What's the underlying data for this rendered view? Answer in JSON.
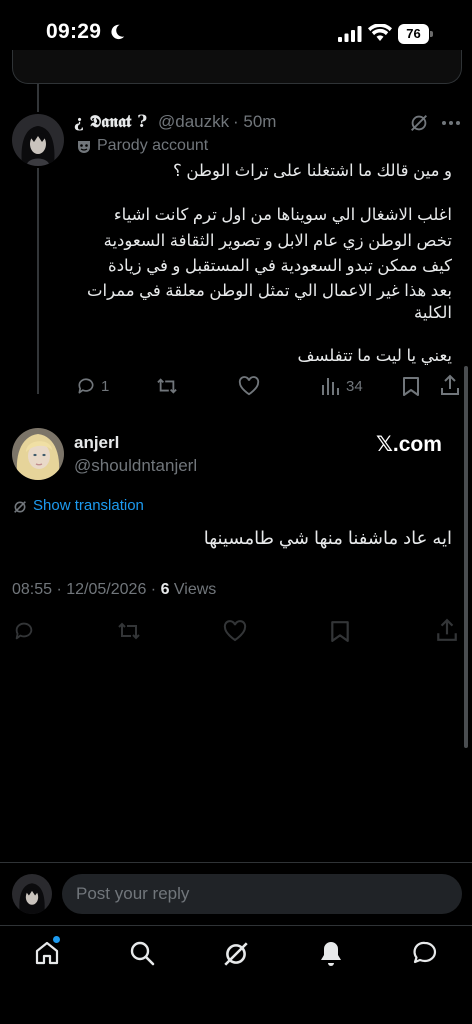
{
  "status_bar": {
    "time": "09:29",
    "battery": "76"
  },
  "parent_tweet": {
    "display_name": "¿ 𝕯𝖆𝖓𝖆𝖙 ?",
    "handle": "@dauzkk",
    "time": "· 50m",
    "badge_label": "Parody account",
    "lines": [
      "و مين قالك ما اشتغلنا على تراث الوطن ؟",
      "",
      "اغلب الاشغال الي سويناها من اول ترم كانت اشياء",
      "تخص الوطن زي عام الابل و تصوير الثقافة السعودية",
      "كيف ممكن تبدو السعودية في المستقبل و في زيادة",
      "بعد هذا غير الاعمال الي تمثل الوطن معلقة في ممرات",
      "الكلية",
      "",
      "يعني يا ليت ما تتفلسف"
    ],
    "reply_count": "1",
    "view_count": "34"
  },
  "main_tweet": {
    "display_name": "anjerl",
    "handle": "@shouldntanjerl",
    "watermark": "𝕏.com",
    "translation_label": "Show translation",
    "text": "ايه عاد ماشفنا منها شي طامسينها",
    "timestamp": "08:55 · 12/05/2026 · ",
    "views_count": "6",
    "views_label": " Views"
  },
  "reply_bar": {
    "placeholder": "Post your reply"
  },
  "bottom_nav": {
    "items": [
      "home",
      "search",
      "grok",
      "notifications",
      "messages"
    ],
    "notification_dot_color": "#1d9bf0"
  },
  "colors": {
    "accent": "#1d9bf0",
    "muted": "#71767b",
    "text": "#e7e9ea"
  }
}
